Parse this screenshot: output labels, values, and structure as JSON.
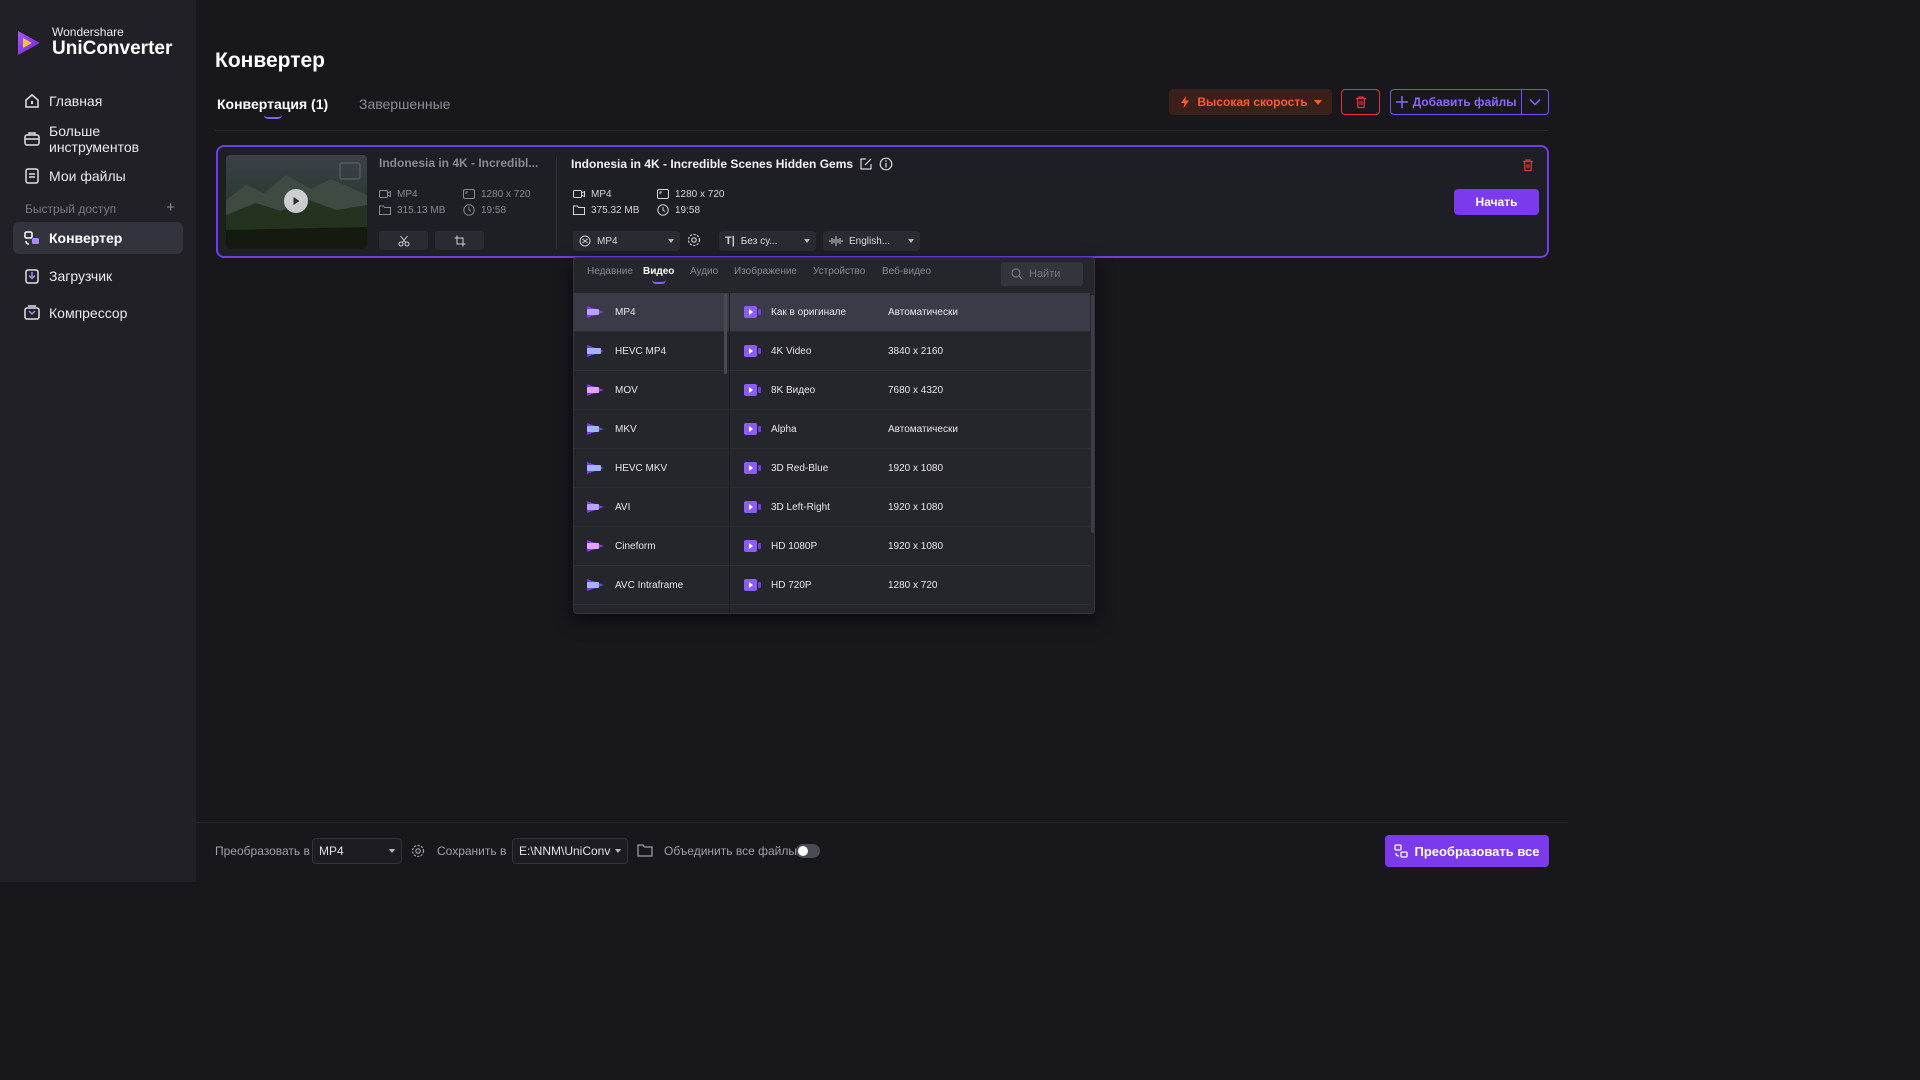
{
  "app": {
    "brand_small": "Wondershare",
    "brand_big": "UniConverter",
    "accent_color": "#7c3aed",
    "speed_color": "#ff5a2a",
    "danger_color": "#e0333a"
  },
  "sidebar": {
    "items": [
      {
        "label": "Главная",
        "icon": "home-icon"
      },
      {
        "label": "Больше инструментов",
        "icon": "toolbox-icon"
      },
      {
        "label": "Мои файлы",
        "icon": "file-icon"
      },
      {
        "label": "Конвертер",
        "icon": "converter-icon",
        "active": true
      },
      {
        "label": "Загрузчик",
        "icon": "download-icon"
      },
      {
        "label": "Компрессор",
        "icon": "compress-icon"
      }
    ],
    "quick_access": "Быстрый доступ",
    "quick_add": "+"
  },
  "header": {
    "title": "Конвертер",
    "tabs": [
      {
        "label": "Конвертация (1)",
        "active": true
      },
      {
        "label": "Завершенные",
        "active": false
      }
    ],
    "speed_button": "Высокая скорость",
    "add_files_button": "Добавить файлы"
  },
  "file": {
    "source": {
      "name": "Indonesia in 4K - Incredibl...",
      "format": "MP4",
      "resolution": "1280 x 720",
      "size": "315.13 MB",
      "duration": "19:58"
    },
    "output": {
      "name": "Indonesia in 4K - Incredible Scenes  Hidden Gems",
      "format": "MP4",
      "resolution": "1280 x 720",
      "size": "375.32 MB",
      "duration": "19:58"
    },
    "format_select": "MP4",
    "subtitle_select": "Без су...",
    "audio_select": "English...",
    "start_button": "Начать"
  },
  "format_panel": {
    "tabs": [
      {
        "label": "Недавние",
        "active": false
      },
      {
        "label": "Видео",
        "active": true
      },
      {
        "label": "Аудио",
        "active": false
      },
      {
        "label": "Изображение",
        "active": false
      },
      {
        "label": "Устройство",
        "active": false
      },
      {
        "label": "Веб-видео",
        "active": false
      }
    ],
    "search_placeholder": "Найти",
    "formats": [
      {
        "label": "MP4",
        "badge": "MP4",
        "active": true
      },
      {
        "label": "HEVC MP4",
        "badge": "HEVC"
      },
      {
        "label": "MOV",
        "badge": "MOV"
      },
      {
        "label": "MKV",
        "badge": "MKV"
      },
      {
        "label": "HEVC MKV",
        "badge": "HEVC"
      },
      {
        "label": "AVI",
        "badge": "AVI"
      },
      {
        "label": "Cineform",
        "badge": "MOV"
      },
      {
        "label": "AVC Intraframe",
        "badge": "MP4"
      }
    ],
    "presets": [
      {
        "label": "Как в оригинале",
        "resolution": "Автоматически",
        "active": true
      },
      {
        "label": "4K Video",
        "resolution": "3840 x 2160"
      },
      {
        "label": "8K Видео",
        "resolution": "7680 x 4320"
      },
      {
        "label": "Alpha",
        "resolution": "Автоматически"
      },
      {
        "label": "3D Red-Blue",
        "resolution": "1920 x 1080"
      },
      {
        "label": "3D Left-Right",
        "resolution": "1920 x 1080"
      },
      {
        "label": "HD 1080P",
        "resolution": "1920 x 1080"
      },
      {
        "label": "HD 720P",
        "resolution": "1280 x 720"
      }
    ]
  },
  "bottom": {
    "convert_to_label": "Преобразовать в",
    "convert_to_value": "MP4",
    "save_to_label": "Сохранить в",
    "save_to_value": "E:\\NNM\\UniConve",
    "merge_label": "Объединить все файлы",
    "merge_enabled": false,
    "convert_all_button": "Преобразовать все"
  }
}
